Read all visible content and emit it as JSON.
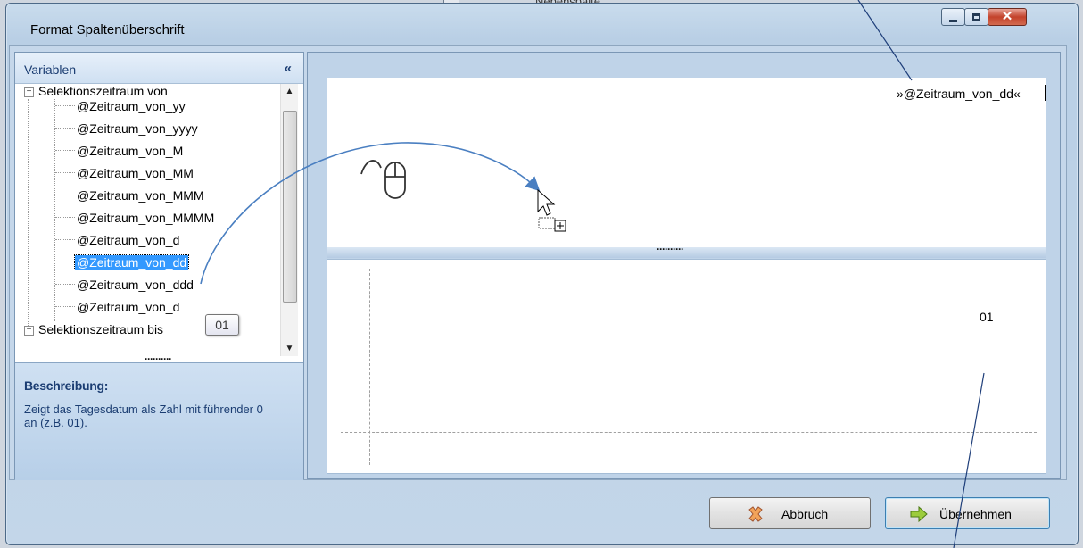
{
  "window": {
    "title": "Format Spaltenüberschrift",
    "background_text": "Nebenspalte"
  },
  "left_pane": {
    "header": "Variablen",
    "collapse_glyph": "«",
    "tree": {
      "root_label": "Selektionszeitraum von",
      "children": [
        "@Zeitraum_von_yy",
        "@Zeitraum_von_yyyy",
        "@Zeitraum_von_M",
        "@Zeitraum_von_MM",
        "@Zeitraum_von_MMM",
        "@Zeitraum_von_MMMM",
        "@Zeitraum_von_d",
        "@Zeitraum_von_dd",
        "@Zeitraum_von_ddd",
        "@Zeitraum_von_d"
      ],
      "selected_child": "@Zeitraum_von_dd",
      "second_root_label": "Selektionszeitraum bis"
    },
    "tooltip": "01",
    "description_title": "Beschreibung:",
    "description_text": "Zeigt das Tagesdatum als Zahl mit führender 0 an (z.B. 01)."
  },
  "right_pane": {
    "inserted_variable": "»@Zeitraum_von_dd«",
    "preview_value": "01"
  },
  "buttons": {
    "cancel": "Abbruch",
    "apply": "Übernehmen"
  },
  "colors": {
    "selection": "#3399ff",
    "arrow": "#4a7fc1",
    "pane_text": "#1b3d72"
  }
}
